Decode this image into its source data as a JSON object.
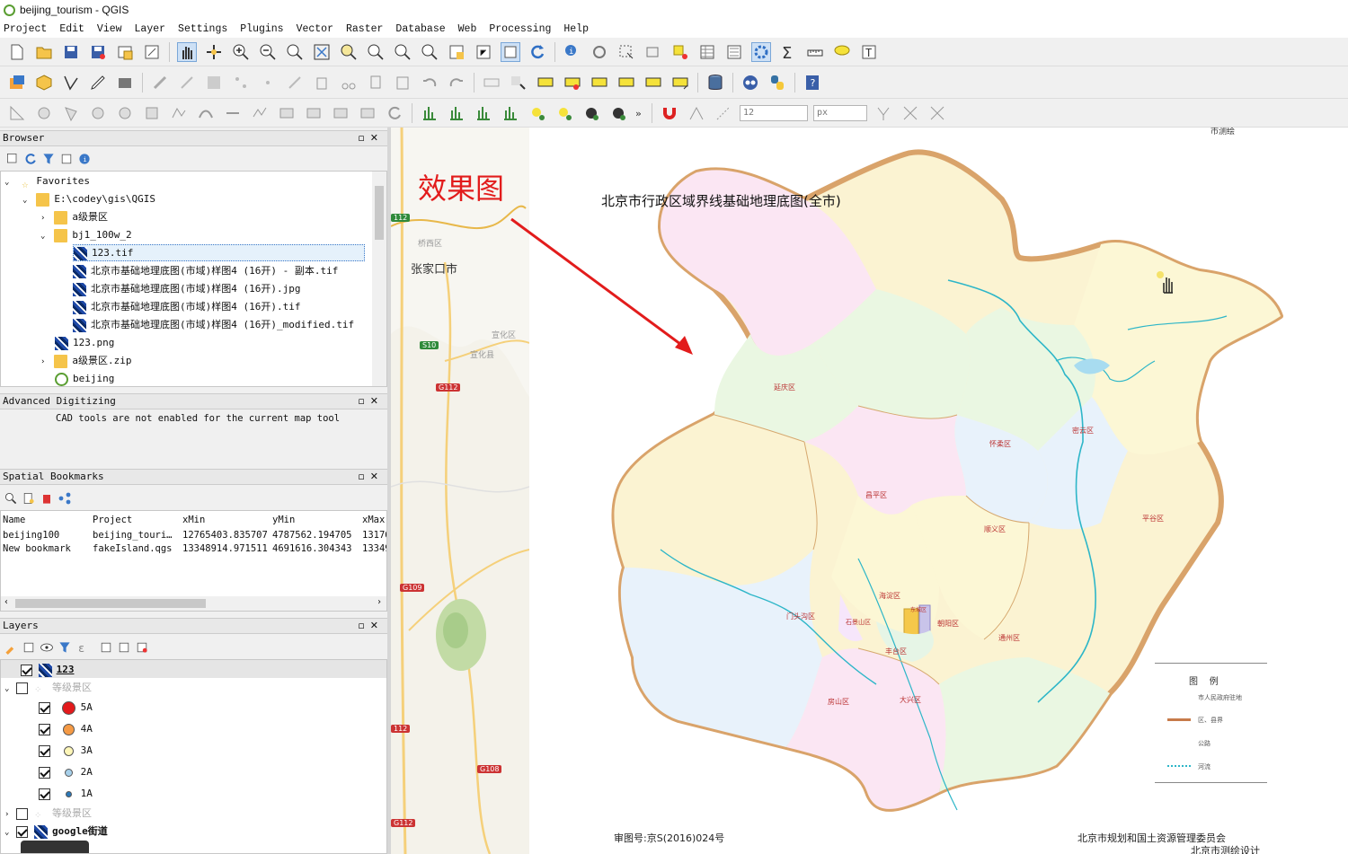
{
  "window": {
    "title": "beijing_tourism - QGIS"
  },
  "menu": [
    "Project",
    "Edit",
    "View",
    "Layer",
    "Settings",
    "Plugins",
    "Vector",
    "Raster",
    "Database",
    "Web",
    "Processing",
    "Help"
  ],
  "toolbar3": {
    "size_value": "12",
    "unit_value": "px"
  },
  "browser": {
    "title": "Browser",
    "items": [
      {
        "label": "Favorites"
      },
      {
        "label": "E:\\codey\\gis\\QGIS"
      },
      {
        "label": "a级景区"
      },
      {
        "label": "bj1_100w_2"
      },
      {
        "label": "123.tif"
      },
      {
        "label": "北京市基础地理底图(市域)样图4 (16开) - 副本.tif"
      },
      {
        "label": "北京市基础地理底图(市域)样图4 (16开).jpg"
      },
      {
        "label": "北京市基础地理底图(市域)样图4 (16开).tif"
      },
      {
        "label": "北京市基础地理底图(市域)样图4 (16开)_modified.tif"
      },
      {
        "label": "123.png"
      },
      {
        "label": "a级景区.zip"
      },
      {
        "label": "beijing"
      }
    ]
  },
  "advanced": {
    "title": "Advanced Digitizing",
    "message": "CAD tools are not enabled for the current map tool"
  },
  "bookmarks": {
    "title": "Spatial Bookmarks",
    "columns": [
      "Name",
      "Project",
      "xMin",
      "yMin",
      "xMax"
    ],
    "rows": [
      [
        "beijing100",
        "beijing_touri…",
        "12765403.835707",
        "4787562.194705",
        "13176"
      ],
      [
        "New bookmark",
        "fakeIsland.qgs",
        "13348914.971511",
        "4691616.304343",
        "13349"
      ]
    ]
  },
  "layers": {
    "title": "Layers",
    "items": [
      {
        "label": "123"
      },
      {
        "label": "等级景区"
      },
      {
        "label": "5A",
        "color": "#e31a1c"
      },
      {
        "label": "4A",
        "color": "#f59a45"
      },
      {
        "label": "3A",
        "color": "#fdf6b8"
      },
      {
        "label": "2A",
        "color": "#a7d0ea"
      },
      {
        "label": "1A",
        "color": "#2b78b8"
      },
      {
        "label": "等级景区"
      },
      {
        "label": "google街道"
      }
    ]
  },
  "map": {
    "annotation": "效果图",
    "map_title": "北京市行政区域界线基础地理底图(全市)",
    "basemap_labels": {
      "city": "张家口市",
      "town1": "桥西区",
      "town2": "宣化区",
      "town3": "宣化县"
    },
    "road_badges": [
      "S10",
      "G112",
      "G109",
      "G108",
      "G112",
      "112",
      "112"
    ],
    "district_labels": [
      "延庆区",
      "怀柔区",
      "密云区",
      "昌平区",
      "顺义区",
      "平谷区",
      "门头沟区",
      "海淀区",
      "朝阳区",
      "通州区",
      "石景山区",
      "丰台区",
      "房山区",
      "大兴区",
      "东城区"
    ],
    "legend": {
      "title": "图    例",
      "items": [
        "市人民政府驻地",
        "区、县界",
        "公路",
        "河流"
      ]
    },
    "footer_left": "审图号:京S(2016)024号",
    "footer_right": "北京市规划和国土资源管理委员会",
    "footer_right2": "北京市测绘设计",
    "corner_text": "市测绘"
  }
}
